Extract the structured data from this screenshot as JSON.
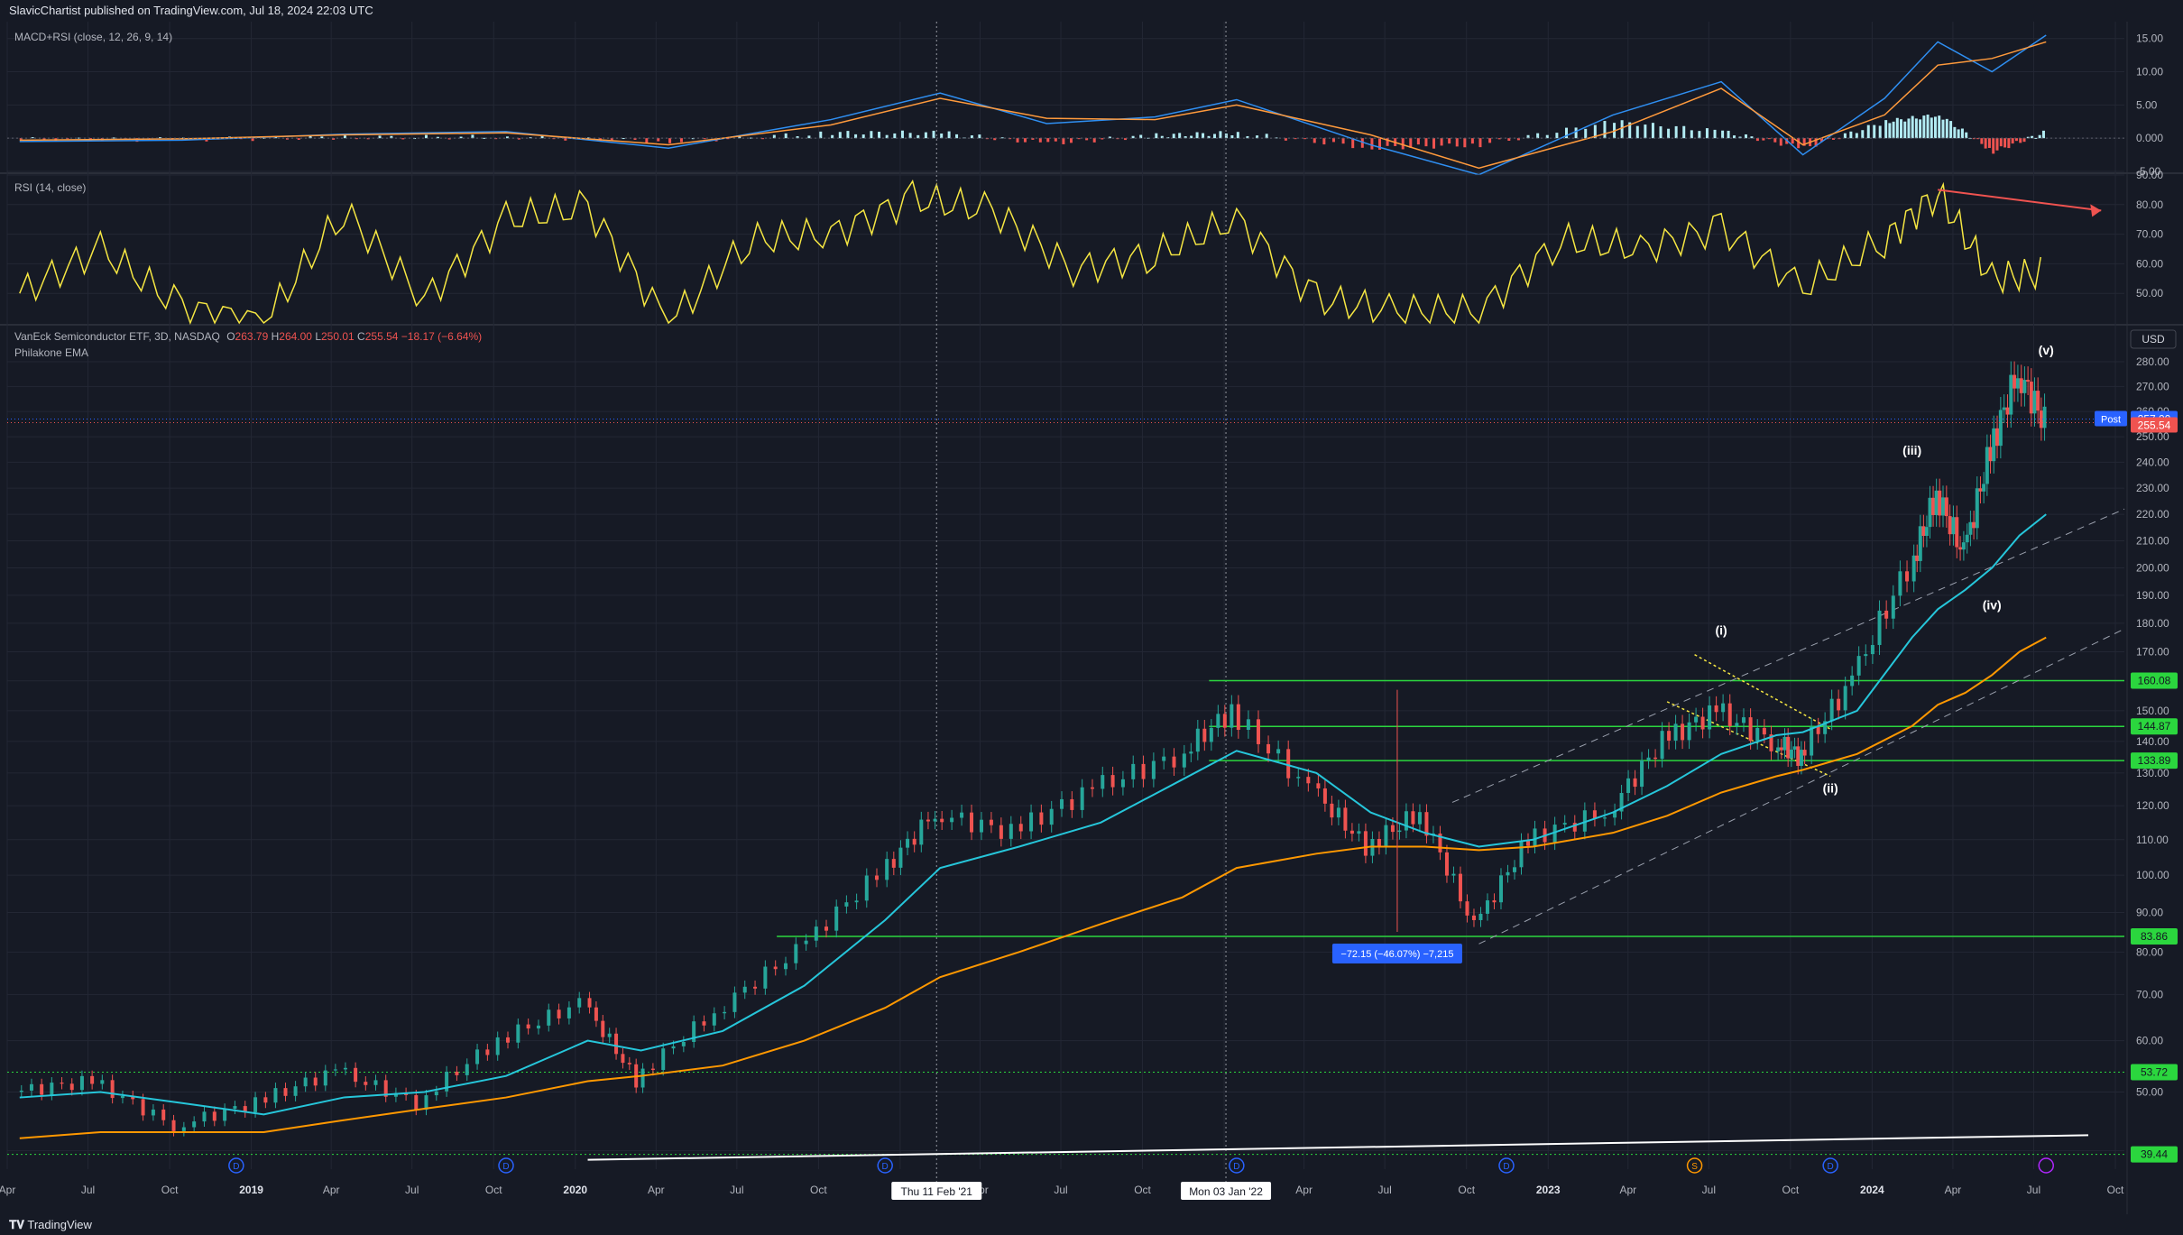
{
  "header": {
    "publisher_text": "SlavicChartist published on TradingView.com, Jul 18, 2024 22:03 UTC"
  },
  "footer": {
    "logo_text": "TradingView"
  },
  "colors": {
    "background": "#161a25",
    "grid": "#232734",
    "macd_line": "#2f8ff2",
    "signal_line": "#ff9a3c",
    "hist_pos": "#b2ebf2",
    "hist_neg": "#ef5350",
    "rsi": "#f5e642",
    "candle_up": "#26a69a",
    "candle_down": "#ef5350",
    "ema_fast": "#26c6da",
    "ema_slow": "#ff9800",
    "support": "#2bd63e",
    "channel": "#9aa0ad",
    "wedge": "#f5e642"
  },
  "chart_data": [
    {
      "type": "line",
      "panel": "macd",
      "title": "MACD+RSI (close, 12, 26, 9, 14)",
      "ylim": [
        -5,
        17
      ],
      "y_ticks": [
        "15.00",
        "10.00",
        "5.00",
        "0.000",
        "-5.00"
      ],
      "x": [
        "2018-04",
        "2018-10",
        "2019-04",
        "2019-10",
        "2020-04",
        "2020-10",
        "2021-02",
        "2021-06",
        "2021-10",
        "2022-01",
        "2022-06",
        "2022-10",
        "2023-03",
        "2023-07",
        "2023-10",
        "2024-01",
        "2024-03",
        "2024-05",
        "2024-07"
      ],
      "series": [
        {
          "values": [
            -0.5,
            -0.3,
            0.6,
            1.0,
            -1.5,
            2.8,
            6.8,
            2.2,
            3.2,
            5.8,
            -1.0,
            -5.5,
            3.5,
            8.5,
            -2.5,
            6.0,
            14.5,
            10.0,
            15.5
          ]
        },
        {
          "values": [
            -0.3,
            -0.1,
            0.5,
            0.8,
            -1.0,
            2.0,
            6.0,
            3.0,
            2.8,
            5.0,
            0.5,
            -4.5,
            1.0,
            7.5,
            -1.0,
            3.5,
            11.0,
            12.0,
            14.5
          ]
        },
        {
          "values": [
            -0.2,
            -0.2,
            0.1,
            0.2,
            -0.5,
            0.8,
            0.8,
            -0.8,
            0.4,
            0.8,
            -1.5,
            -1.0,
            2.5,
            1.0,
            -1.5,
            2.5,
            3.5,
            -2.0,
            1.0
          ]
        }
      ]
    },
    {
      "type": "line",
      "panel": "rsi",
      "title": "RSI (14, close)",
      "ylim": [
        40,
        90
      ],
      "y_ticks": [
        "90.00",
        "80.00",
        "70.00",
        "60.00",
        "50.00"
      ],
      "x": [
        "2018-04",
        "2018-07",
        "2018-10",
        "2019-01",
        "2019-04",
        "2019-07",
        "2019-10",
        "2020-01",
        "2020-04",
        "2020-07",
        "2020-10",
        "2021-01",
        "2021-04",
        "2021-07",
        "2021-10",
        "2022-01",
        "2022-04",
        "2022-07",
        "2022-10",
        "2023-01",
        "2023-04",
        "2023-07",
        "2023-10",
        "2024-01",
        "2024-03",
        "2024-05",
        "2024-07"
      ],
      "values": [
        50,
        65,
        45,
        40,
        78,
        48,
        75,
        79,
        40,
        68,
        70,
        82,
        78,
        58,
        63,
        75,
        48,
        44,
        44,
        68,
        65,
        72,
        52,
        68,
        84,
        55,
        57
      ],
      "divergence_line": {
        "from": [
          "2024-03",
          85
        ],
        "to": [
          "2024-09",
          78
        ]
      }
    },
    {
      "type": "candlestick",
      "panel": "price",
      "title": "VanEck Semiconductor ETF, 3D, NASDAQ",
      "ohlc_label": {
        "o_key": "O",
        "o": "263.79",
        "h_key": "H",
        "h": "264.00",
        "l_key": "L",
        "l": "250.01",
        "c_key": "C",
        "c": "255.54",
        "change": "−18.17 (−6.64%)"
      },
      "indicator_label": "Philakone EMA",
      "currency": "USD",
      "ylim": [
        38,
        287
      ],
      "y_ticks": [
        "280.00",
        "270.00",
        "260.00",
        "250.00",
        "240.00",
        "230.00",
        "220.00",
        "210.00",
        "200.00",
        "190.00",
        "180.00",
        "170.00",
        "160.00",
        "150.00",
        "140.00",
        "130.00",
        "120.00",
        "110.00",
        "100.00",
        "90.00",
        "80.00",
        "70.00",
        "60.00",
        "50.00",
        "40.00"
      ],
      "x_ticks": [
        "Apr",
        "Jul",
        "Oct",
        "2019",
        "Apr",
        "Jul",
        "Oct",
        "2020",
        "Apr",
        "Jul",
        "Oct",
        "",
        "Apr",
        "Jul",
        "Oct",
        "",
        "Apr",
        "Jul",
        "Oct",
        "2023",
        "Apr",
        "Jul",
        "Oct",
        "2024",
        "Apr",
        "Jul",
        "Oct"
      ],
      "x": [
        "2018-04",
        "2018-07",
        "2018-10",
        "2019-01",
        "2019-04",
        "2019-07",
        "2019-10",
        "2020-01",
        "2020-03",
        "2020-06",
        "2020-09",
        "2020-12",
        "2021-02",
        "2021-05",
        "2021-08",
        "2021-11",
        "2022-01",
        "2022-04",
        "2022-06",
        "2022-08",
        "2022-10",
        "2022-12",
        "2023-03",
        "2023-05",
        "2023-07",
        "2023-09",
        "2023-10",
        "2023-12",
        "2024-02",
        "2024-03",
        "2024-04",
        "2024-05",
        "2024-06",
        "2024-07"
      ],
      "close": [
        50,
        52,
        44,
        48,
        54,
        48,
        60,
        68,
        52,
        66,
        80,
        100,
        118,
        112,
        125,
        135,
        150,
        125,
        108,
        118,
        86,
        110,
        118,
        140,
        150,
        140,
        135,
        160,
        200,
        228,
        205,
        245,
        276,
        255.54
      ],
      "ema_fast": [
        49,
        50,
        48,
        46,
        49,
        50,
        53,
        60,
        58,
        62,
        72,
        88,
        102,
        108,
        115,
        128,
        137,
        130,
        118,
        112,
        108,
        110,
        118,
        126,
        136,
        142,
        143,
        150,
        175,
        185,
        192,
        200,
        212,
        220
      ],
      "ema_slow": [
        42,
        43,
        43,
        43,
        45,
        47,
        49,
        52,
        53,
        55,
        60,
        67,
        74,
        80,
        87,
        94,
        102,
        106,
        108,
        108,
        107,
        108,
        112,
        117,
        124,
        129,
        131,
        136,
        145,
        152,
        156,
        162,
        170,
        175
      ],
      "horizontal_levels": [
        "160.08",
        "144.87",
        "133.89",
        "83.86",
        "53.72",
        "39.44"
      ],
      "post_market": {
        "label": "Post",
        "value": "257.00"
      },
      "last_price": "255.54",
      "wave_labels": [
        "(i)",
        "(ii)",
        "(iii)",
        "(iv)",
        "(v)"
      ],
      "measure_label": "−72.15 (−46.07%) −7,215",
      "crosshair_dates": [
        "Thu 11 Feb '21",
        "Mon 03 Jan '22"
      ],
      "event_markers": [
        "D",
        "D",
        "D",
        "D",
        "D",
        "S",
        "D"
      ]
    }
  ]
}
